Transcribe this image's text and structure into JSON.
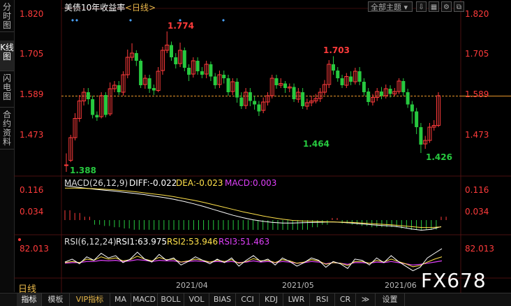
{
  "sidebar": {
    "tabs": [
      {
        "label": "分时图",
        "active": false
      },
      {
        "label": "K线图",
        "active": true
      },
      {
        "label": "闪电图",
        "active": false
      },
      {
        "label": "合约资料",
        "active": false
      }
    ]
  },
  "header": {
    "title": "美债10年收益率",
    "period_tag": "<日线>",
    "theme_button": "全部主题",
    "tool_icons": [
      "download-icon",
      "grid-icon",
      "settings-icon",
      "restore-icon"
    ]
  },
  "main_axis": {
    "ticks": [
      "1.820",
      "1.705",
      "1.589",
      "1.473"
    ],
    "annotations": {
      "high1": "1.774",
      "high2": "1.703",
      "low_start": "1.388",
      "low_mid": "1.464",
      "low_end": "1.426"
    },
    "reference_line": "1.589"
  },
  "macd": {
    "title": "MACD(26,12,9)",
    "diff_label": "DIFF:-0.022",
    "dea_label": "DEA:-0.023",
    "macd_label": "MACD:0.003",
    "ticks": [
      "0.116",
      "0.034"
    ]
  },
  "rsi": {
    "title": "RSI(6,12,24)",
    "rsi1_label": "RSI1:63.975",
    "rsi2_label": "RSI2:53.946",
    "rsi3_label": "RSI3:51.463",
    "ticks": [
      "82.013"
    ]
  },
  "x_axis": {
    "dates": [
      "2021/04",
      "2021/05",
      "2021/06"
    ]
  },
  "daily_label": "日线",
  "watermark": "FX678",
  "bottom_tabs": [
    {
      "label": "指标",
      "active": true,
      "vip": false
    },
    {
      "label": "模板",
      "active": false,
      "vip": false
    },
    {
      "label": "VIP指标",
      "active": false,
      "vip": true
    },
    {
      "label": "MA",
      "active": false,
      "vip": false
    },
    {
      "label": "MACD",
      "active": false,
      "vip": false
    },
    {
      "label": "BOLL",
      "active": false,
      "vip": false
    },
    {
      "label": "VOL",
      "active": false,
      "vip": false
    },
    {
      "label": "BIAS",
      "active": false,
      "vip": false
    },
    {
      "label": "CCI",
      "active": false,
      "vip": false
    },
    {
      "label": "KDJ",
      "active": false,
      "vip": false
    },
    {
      "label": "LWR",
      "active": false,
      "vip": false
    },
    {
      "label": "RSI",
      "active": false,
      "vip": false
    },
    {
      "label": "CR",
      "active": false,
      "vip": false
    },
    {
      "label": "≫",
      "active": false,
      "vip": false
    },
    {
      "label": "设置",
      "active": false,
      "vip": false
    }
  ],
  "colors": {
    "up": "#ff3b3b",
    "down": "#27c93f",
    "diff": "#ffffff",
    "dea": "#ffe14a",
    "rsi1": "#ffffff",
    "rsi2": "#ffe14a",
    "rsi3": "#e040fb",
    "ref_line": "#e8962a"
  },
  "chart_data": {
    "type": "candlestick",
    "ylim": [
      1.36,
      1.84
    ],
    "candles": [
      [
        1.392,
        1.392,
        1.425,
        1.372
      ],
      [
        1.405,
        1.47,
        1.478,
        1.4
      ],
      [
        1.47,
        1.525,
        1.54,
        1.462
      ],
      [
        1.525,
        1.575,
        1.592,
        1.515
      ],
      [
        1.575,
        1.6,
        1.612,
        1.562
      ],
      [
        1.6,
        1.58,
        1.612,
        1.565
      ],
      [
        1.58,
        1.535,
        1.59,
        1.525
      ],
      [
        1.535,
        1.528,
        1.545,
        1.518
      ],
      [
        1.53,
        1.59,
        1.6,
        1.525
      ],
      [
        1.592,
        1.535,
        1.6,
        1.528
      ],
      [
        1.538,
        1.61,
        1.628,
        1.532
      ],
      [
        1.61,
        1.62,
        1.632,
        1.6
      ],
      [
        1.62,
        1.6,
        1.632,
        1.592
      ],
      [
        1.6,
        1.65,
        1.66,
        1.59
      ],
      [
        1.65,
        1.7,
        1.722,
        1.64
      ],
      [
        1.7,
        1.712,
        1.74,
        1.69
      ],
      [
        1.712,
        1.69,
        1.72,
        1.675
      ],
      [
        1.69,
        1.62,
        1.695,
        1.612
      ],
      [
        1.622,
        1.64,
        1.65,
        1.61
      ],
      [
        1.64,
        1.61,
        1.65,
        1.598
      ],
      [
        1.612,
        1.605,
        1.622,
        1.592
      ],
      [
        1.605,
        1.66,
        1.672,
        1.6
      ],
      [
        1.662,
        1.72,
        1.73,
        1.65
      ],
      [
        1.72,
        1.735,
        1.774,
        1.712
      ],
      [
        1.735,
        1.7,
        1.745,
        1.69
      ],
      [
        1.7,
        1.68,
        1.712,
        1.668
      ],
      [
        1.682,
        1.72,
        1.742,
        1.672
      ],
      [
        1.72,
        1.67,
        1.728,
        1.66
      ],
      [
        1.67,
        1.65,
        1.68,
        1.632
      ],
      [
        1.652,
        1.69,
        1.7,
        1.642
      ],
      [
        1.69,
        1.66,
        1.7,
        1.65
      ],
      [
        1.66,
        1.65,
        1.672,
        1.64
      ],
      [
        1.652,
        1.68,
        1.69,
        1.64
      ],
      [
        1.68,
        1.645,
        1.688,
        1.632
      ],
      [
        1.645,
        1.62,
        1.655,
        1.61
      ],
      [
        1.622,
        1.65,
        1.662,
        1.612
      ],
      [
        1.65,
        1.64,
        1.662,
        1.625
      ],
      [
        1.64,
        1.6,
        1.65,
        1.59
      ],
      [
        1.602,
        1.63,
        1.64,
        1.592
      ],
      [
        1.63,
        1.585,
        1.64,
        1.57
      ],
      [
        1.585,
        1.56,
        1.6,
        1.552
      ],
      [
        1.562,
        1.6,
        1.612,
        1.552
      ],
      [
        1.6,
        1.575,
        1.612,
        1.56
      ],
      [
        1.575,
        1.565,
        1.59,
        1.55
      ],
      [
        1.565,
        1.545,
        1.575,
        1.532
      ],
      [
        1.548,
        1.572,
        1.585,
        1.54
      ],
      [
        1.572,
        1.59,
        1.6,
        1.562
      ],
      [
        1.59,
        1.64,
        1.65,
        1.582
      ],
      [
        1.64,
        1.62,
        1.65,
        1.61
      ],
      [
        1.62,
        1.625,
        1.64,
        1.612
      ],
      [
        1.625,
        1.612,
        1.632,
        1.598
      ],
      [
        1.612,
        1.615,
        1.625,
        1.6
      ],
      [
        1.615,
        1.58,
        1.625,
        1.572
      ],
      [
        1.58,
        1.6,
        1.612,
        1.57
      ],
      [
        1.6,
        1.56,
        1.612,
        1.552
      ],
      [
        1.56,
        1.57,
        1.582,
        1.55
      ],
      [
        1.57,
        1.575,
        1.59,
        1.56
      ],
      [
        1.575,
        1.582,
        1.595,
        1.568
      ],
      [
        1.582,
        1.6,
        1.612,
        1.572
      ],
      [
        1.6,
        1.622,
        1.635,
        1.592
      ],
      [
        1.622,
        1.68,
        1.692,
        1.612
      ],
      [
        1.68,
        1.662,
        1.703,
        1.65
      ],
      [
        1.662,
        1.64,
        1.672,
        1.63
      ],
      [
        1.64,
        1.62,
        1.65,
        1.612
      ],
      [
        1.62,
        1.645,
        1.655,
        1.612
      ],
      [
        1.645,
        1.63,
        1.66,
        1.62
      ],
      [
        1.63,
        1.66,
        1.67,
        1.622
      ],
      [
        1.66,
        1.63,
        1.672,
        1.62
      ],
      [
        1.63,
        1.6,
        1.64,
        1.59
      ],
      [
        1.602,
        1.572,
        1.612,
        1.562
      ],
      [
        1.572,
        1.585,
        1.595,
        1.562
      ],
      [
        1.585,
        1.602,
        1.612,
        1.575
      ],
      [
        1.602,
        1.59,
        1.615,
        1.58
      ],
      [
        1.59,
        1.61,
        1.622,
        1.582
      ],
      [
        1.61,
        1.595,
        1.62,
        1.585
      ],
      [
        1.595,
        1.602,
        1.612,
        1.59
      ],
      [
        1.602,
        1.632,
        1.64,
        1.595
      ],
      [
        1.632,
        1.6,
        1.64,
        1.59
      ],
      [
        1.6,
        1.565,
        1.61,
        1.555
      ],
      [
        1.565,
        1.545,
        1.575,
        1.51
      ],
      [
        1.545,
        1.5,
        1.555,
        1.48
      ],
      [
        1.5,
        1.45,
        1.512,
        1.426
      ],
      [
        1.452,
        1.462,
        1.475,
        1.438
      ],
      [
        1.462,
        1.5,
        1.512,
        1.455
      ],
      [
        1.5,
        1.505,
        1.52,
        1.49
      ],
      [
        1.505,
        1.59,
        1.6,
        1.5
      ]
    ],
    "macd_diff": [
      0.116,
      0.112,
      0.108,
      0.104,
      0.101,
      0.098,
      0.094,
      0.09,
      0.086,
      0.081,
      0.076,
      0.07,
      0.063,
      0.055,
      0.046,
      0.036,
      0.026,
      0.016,
      0.008,
      0.001,
      -0.004,
      -0.008,
      -0.01,
      -0.01,
      -0.009,
      -0.008,
      -0.007,
      -0.006,
      -0.008,
      -0.01,
      -0.013,
      -0.016,
      -0.018,
      -0.02,
      -0.024,
      -0.03,
      -0.034,
      -0.031,
      -0.022
    ],
    "macd_dea": [
      0.108,
      0.108,
      0.107,
      0.106,
      0.104,
      0.102,
      0.099,
      0.096,
      0.092,
      0.088,
      0.084,
      0.079,
      0.073,
      0.067,
      0.06,
      0.052,
      0.044,
      0.036,
      0.028,
      0.021,
      0.014,
      0.008,
      0.003,
      -0.001,
      -0.003,
      -0.004,
      -0.005,
      -0.006,
      -0.007,
      -0.008,
      -0.01,
      -0.012,
      -0.014,
      -0.016,
      -0.019,
      -0.022,
      -0.025,
      -0.025,
      -0.023
    ],
    "rsi1": [
      55,
      60,
      52,
      64,
      58,
      70,
      62,
      66,
      54,
      60,
      72,
      60,
      55,
      68,
      58,
      62,
      50,
      56,
      64,
      58,
      52,
      60,
      54,
      62,
      48,
      58,
      66,
      56,
      60,
      50,
      62,
      56,
      48,
      54,
      62,
      58,
      46,
      56,
      52,
      44,
      60,
      58,
      50,
      62,
      54,
      66,
      56,
      48,
      40,
      46,
      62,
      70,
      78
    ],
    "rsi2": [
      54,
      56,
      54,
      60,
      58,
      64,
      60,
      62,
      57,
      59,
      65,
      60,
      57,
      63,
      59,
      60,
      55,
      57,
      60,
      58,
      55,
      58,
      56,
      59,
      53,
      56,
      61,
      57,
      58,
      54,
      59,
      57,
      53,
      55,
      59,
      57,
      51,
      54,
      53,
      49,
      56,
      56,
      53,
      58,
      55,
      60,
      56,
      52,
      47,
      49,
      55,
      60,
      64
    ],
    "rsi3": [
      53,
      54,
      54,
      56,
      56,
      58,
      57,
      58,
      56,
      57,
      59,
      58,
      56,
      58,
      57,
      57,
      55,
      56,
      57,
      56,
      55,
      56,
      55,
      56,
      54,
      55,
      57,
      55,
      56,
      54,
      56,
      55,
      53,
      54,
      56,
      55,
      52,
      54,
      53,
      51,
      54,
      54,
      53,
      55,
      54,
      56,
      54,
      52,
      50,
      51,
      53,
      55,
      57
    ]
  }
}
